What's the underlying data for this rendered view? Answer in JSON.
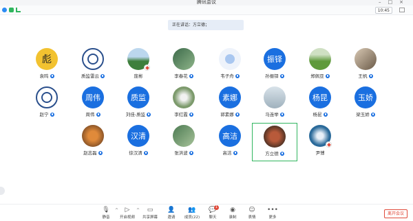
{
  "window": {
    "title": "腾讯会议"
  },
  "infobar": {
    "clock": "10:45"
  },
  "speaking": {
    "text": "正在讲话：方立德；"
  },
  "participants": [
    {
      "name": "袁鸣",
      "initials": "",
      "mic": true
    },
    {
      "name": "质监雷云",
      "initials": "",
      "mic": true
    },
    {
      "name": "庞彬",
      "initials": "",
      "mic": false
    },
    {
      "name": "李春花",
      "initials": "",
      "mic": true
    },
    {
      "name": "韦子舟",
      "initials": "",
      "mic": true
    },
    {
      "name": "孙振铎",
      "initials": "振铎",
      "mic": true
    },
    {
      "name": "郑佩亚",
      "initials": "",
      "mic": true
    },
    {
      "name": "王帆",
      "initials": "",
      "mic": true
    },
    {
      "name": "赵宁",
      "initials": "",
      "mic": true
    },
    {
      "name": "周伟",
      "initials": "周伟",
      "mic": true
    },
    {
      "name": "刘佳-质监",
      "initials": "质监",
      "mic": true
    },
    {
      "name": "李红霞",
      "initials": "",
      "mic": true
    },
    {
      "name": "郭素娜",
      "initials": "素娜",
      "mic": true
    },
    {
      "name": "马连举",
      "initials": "",
      "mic": true
    },
    {
      "name": "杨昆",
      "initials": "杨昆",
      "mic": true
    },
    {
      "name": "梁玉娇",
      "initials": "玉娇",
      "mic": true
    },
    {
      "name": "赵志磊",
      "initials": "",
      "mic": true
    },
    {
      "name": "徐汉清",
      "initials": "汉清",
      "mic": true
    },
    {
      "name": "张洪波",
      "initials": "",
      "mic": true
    },
    {
      "name": "高洁",
      "initials": "高洁",
      "mic": true
    },
    {
      "name": "方立德",
      "initials": "",
      "mic": true
    },
    {
      "name": "尹博",
      "initials": "",
      "mic": false
    }
  ],
  "toolbar": {
    "mute": "静音",
    "video": "开启视频",
    "share": "共享屏幕",
    "invite": "邀请",
    "members": "成员(22)",
    "chat": "聊天",
    "chat_count": "1",
    "record": "录制",
    "reactions": "表情",
    "more": "更多"
  },
  "leave": {
    "label": "离开会议"
  },
  "colors": {
    "accent": "#1a6fe0",
    "danger": "#e04a3a",
    "active": "#2fb55e"
  }
}
